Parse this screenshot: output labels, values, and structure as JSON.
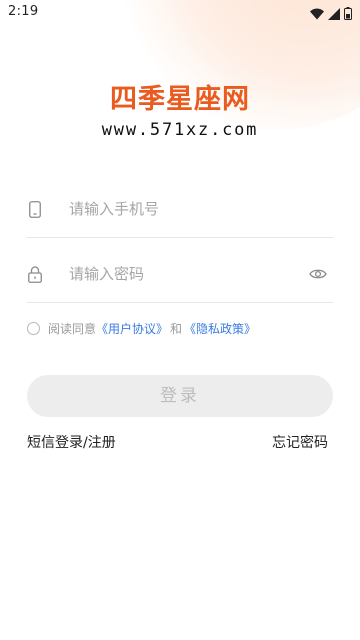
{
  "status_bar": {
    "time": "2:19"
  },
  "brand": {
    "logo_text": "四季星座网",
    "url": "www.571xz.com",
    "color": "#ea5b1f"
  },
  "form": {
    "phone": {
      "icon": "phone-icon",
      "placeholder": "请输入手机号",
      "value": ""
    },
    "password": {
      "icon": "lock-icon",
      "placeholder": "请输入密码",
      "value": "",
      "toggle_icon": "eye-icon"
    }
  },
  "agreement": {
    "checked": false,
    "prefix": "阅读同意",
    "user_agreement": "《用户协议》",
    "conjunction": "和",
    "privacy_policy": "《隐私政策》",
    "link_color": "#3a7be0"
  },
  "login_button": {
    "label": "登录"
  },
  "links": {
    "sms_login": "短信登录/注册",
    "forgot_password": "忘记密码"
  }
}
